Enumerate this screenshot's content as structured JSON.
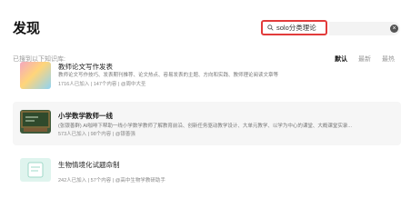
{
  "page": {
    "title": "发现"
  },
  "search": {
    "value": "solo分类理论",
    "clear_icon": "close-circle-icon",
    "search_icon": "search-icon"
  },
  "results": {
    "heading": "已搜到以下知识库:",
    "sort_options": [
      "默认",
      "最新",
      "最热"
    ],
    "active_sort": "默认",
    "items": [
      {
        "title": "教师论文写作发表",
        "description": "教师论文写作技巧、发表期刊推荐、论文热点、容易发表的主题、方向和实践、教师理论阅读文章等",
        "stats": "1716人已加入 | 147个内容 | @周中大圣"
      },
      {
        "title": "小学数学教师一线",
        "description": "(张银善群) AI咖啡下帮助一线小学数学教师了解教育前沿、创新任务驱动教学设计、大单元教学、以学为中心的课堂、大概课堂实录...",
        "stats": "573人已加入 | 98个内容 | @银善强"
      },
      {
        "title": "生物情境化试题命制",
        "description": "",
        "stats": "242人已加入 | 57个内容 | @高中生物学教研助手"
      }
    ]
  }
}
